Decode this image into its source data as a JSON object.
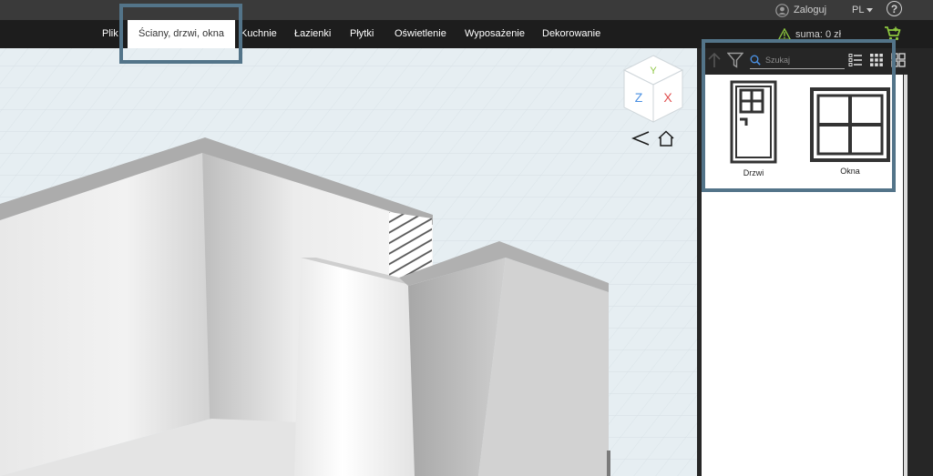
{
  "topbar": {
    "login_label": "Zaloguj",
    "language": "PL"
  },
  "menu": {
    "items": [
      "Plik",
      "Ściany, drzwi, okna",
      "Kuchnie",
      "Łazienki",
      "Płytki",
      "Oświetlenie",
      "Wyposażenie",
      "Dekorowanie"
    ],
    "active": "Ściany, drzwi, okna"
  },
  "summary": {
    "label": "suma: 0 zł"
  },
  "axes": {
    "y": "Y",
    "z": "Z",
    "x": "X"
  },
  "panel": {
    "search_placeholder": "Szukaj",
    "items": [
      {
        "label": "Drzwi",
        "icon": "door-icon"
      },
      {
        "label": "Okna",
        "icon": "window-icon"
      }
    ]
  },
  "colors": {
    "accent_green": "#8cc63f",
    "highlight_border": "#537489"
  }
}
